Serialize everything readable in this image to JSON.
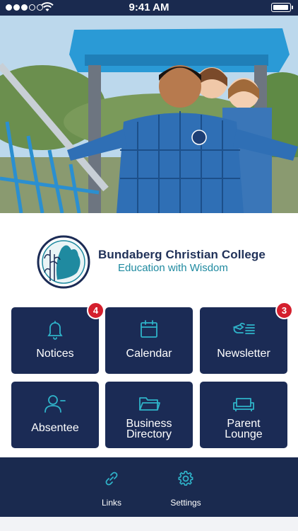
{
  "status_bar": {
    "time": "9:41 AM",
    "signal_bars": 3,
    "battery_level": 0.9
  },
  "school": {
    "name": "Bundaberg Christian College",
    "motto": "Education with Wisdom"
  },
  "tiles": [
    {
      "label": "Notices",
      "icon": "bell-icon",
      "badge": "4"
    },
    {
      "label": "Calendar",
      "icon": "calendar-icon"
    },
    {
      "label": "Newsletter",
      "icon": "newsletter-icon",
      "badge": "3"
    },
    {
      "label": "Absentee",
      "icon": "user-minus-icon"
    },
    {
      "label_line1": "Business",
      "label_line2": "Directory",
      "icon": "folder-icon"
    },
    {
      "label_line1": "Parent",
      "label_line2": "Lounge",
      "icon": "sofa-icon"
    }
  ],
  "bottom_nav": [
    {
      "label": "Links",
      "icon": "link-icon"
    },
    {
      "label": "Settings",
      "icon": "gear-icon"
    }
  ],
  "colors": {
    "navy": "#1b2b55",
    "teal": "#1f8aa0",
    "badge_red": "#d4202e"
  }
}
